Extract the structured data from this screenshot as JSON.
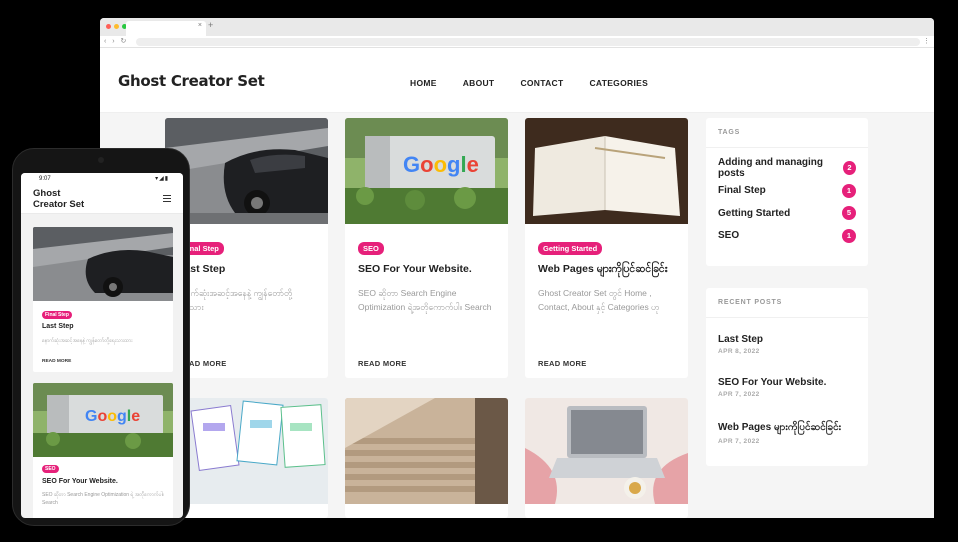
{
  "browser": {
    "tab_close": "×",
    "tab_plus": "+",
    "nav_arrows": "‹ › ↻",
    "menu_kebab": "⋮"
  },
  "site": {
    "brand": "Ghost Creator Set",
    "menu": [
      "HOME",
      "ABOUT",
      "CONTACT",
      "CATEGORIES"
    ]
  },
  "posts": [
    {
      "tag": "Final Step",
      "title": "Last Step",
      "excerpt": "နောက်ဆုံးအဆင့်အနေနဲ့ ကျွန်တော်တို့ရေးသား",
      "read_more": "READ MORE",
      "image": "car-image"
    },
    {
      "tag": "SEO",
      "title": "SEO For Your Website.",
      "excerpt": "SEO ဆိုတာ Search Engine Optimization ရဲ့အတိုကောက်ပါ။ Search",
      "read_more": "READ MORE",
      "image": "google-sign-image"
    },
    {
      "tag": "Getting Started",
      "title": "Web Pages များကိုပြင်ဆင်ခြင်း",
      "excerpt": "Ghost Creator Set တွင် Home , Contact, About နှင့် Categories ဟု",
      "read_more": "READ MORE",
      "image": "notebook-image"
    }
  ],
  "tags_widget": {
    "title": "TAGS",
    "items": [
      {
        "name": "Adding and managing posts",
        "count": "2"
      },
      {
        "name": "Final Step",
        "count": "1"
      },
      {
        "name": "Getting Started",
        "count": "5"
      },
      {
        "name": "SEO",
        "count": "1"
      }
    ]
  },
  "recent_widget": {
    "title": "RECENT POSTS",
    "items": [
      {
        "title": "Last Step",
        "date": "APR 8, 2022"
      },
      {
        "title": "SEO For Your Website.",
        "date": "APR 7, 2022"
      },
      {
        "title": "Web Pages များကိုပြင်ဆင်ခြင်း",
        "date": "APR 7, 2022"
      }
    ]
  },
  "phone": {
    "time": "9:07",
    "status_icons": "▾◢▮",
    "brand_line1": "Ghost",
    "brand_line2": "Creator Set",
    "posts": [
      {
        "tag": "Final Step",
        "title": "Last Step",
        "excerpt": "နောက်ဆုံးအဆင့်အနေနဲ့ ကျွန်တော်တို့ရေးသားထား",
        "read_more": "READ MORE"
      },
      {
        "tag": "SEO",
        "title": "SEO For Your Website.",
        "excerpt": "SEO ဆိုတာ Search Engine Optimization ရဲ့ အတိုကောက်ပါ။ Search",
        "read_more": ""
      }
    ]
  },
  "colors": {
    "accent": "#e6207a",
    "background": "#f5f5f5",
    "text": "#222222"
  }
}
